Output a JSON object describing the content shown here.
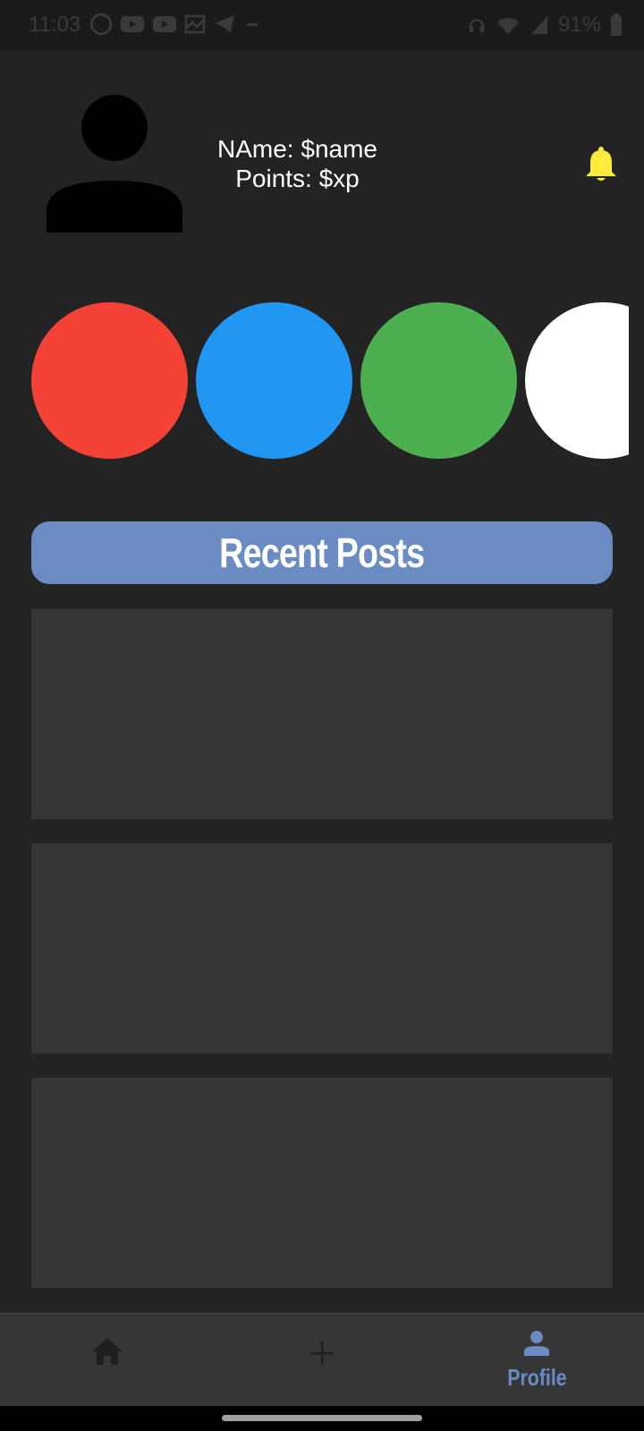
{
  "status_bar": {
    "time": "11:03",
    "battery": "91%",
    "left_icons": [
      "whatsapp-icon",
      "youtube-icon",
      "youtube-icon",
      "gallery-icon",
      "telegram-icon",
      "minus-icon"
    ],
    "right_icons": [
      "headset-icon",
      "wifi-icon",
      "signal-icon",
      "battery-icon"
    ]
  },
  "profile": {
    "name_line": "NAme: $name",
    "points_line": "Points: $xp",
    "avatar_icon": "person-icon",
    "notification_icon": "bell-icon"
  },
  "stories": {
    "colors": [
      "#f44336",
      "#2196f3",
      "#4caf50",
      "#ffffff"
    ]
  },
  "recent_posts": {
    "header": "Recent Posts",
    "posts": [
      {},
      {},
      {}
    ]
  },
  "bottom_nav": {
    "items": [
      {
        "icon": "home-icon",
        "label": ""
      },
      {
        "icon": "plus-icon",
        "label": ""
      },
      {
        "icon": "person-icon",
        "label": "Profile"
      }
    ],
    "active_color": "#6b8bc3",
    "inactive_color": "#1f1f1f"
  },
  "colors": {
    "background": "#232323",
    "card": "#353535",
    "accent": "#6b8bc3",
    "bell": "#ffeb3b"
  }
}
